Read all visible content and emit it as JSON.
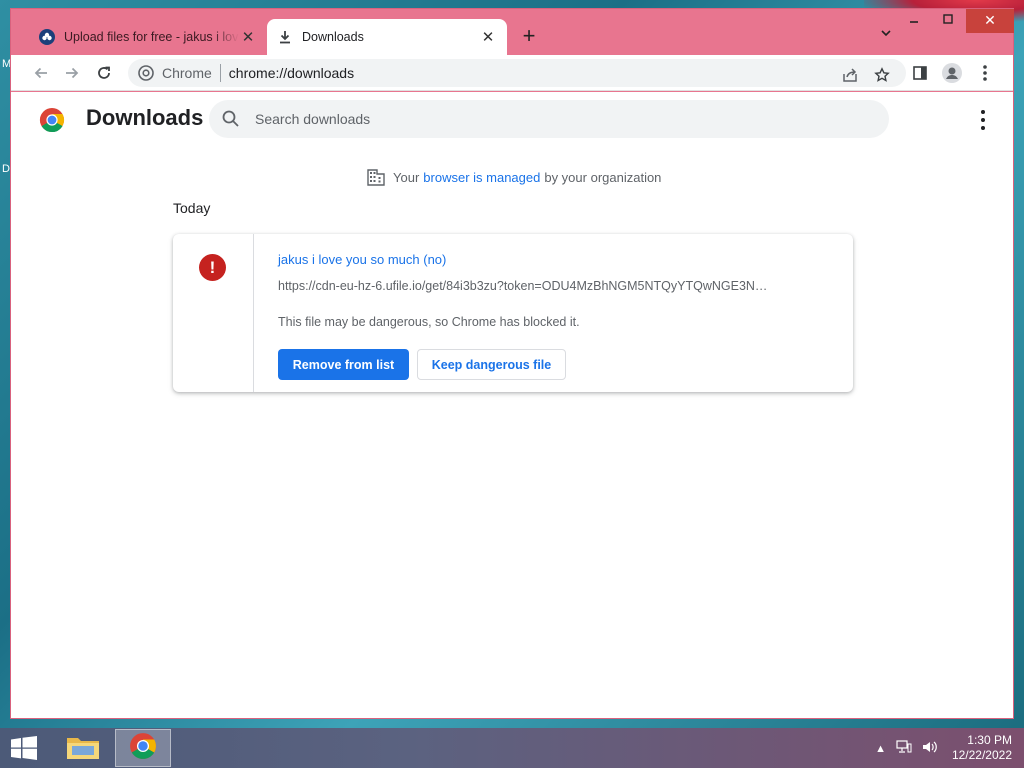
{
  "desktop": {
    "edge_letters": [
      "M",
      "D"
    ]
  },
  "browser": {
    "tabs": [
      {
        "title": "Upload files for free - jakus i love you so much (no)",
        "favicon": "ufile-icon",
        "active": false
      },
      {
        "title": "Downloads",
        "favicon": "download-icon",
        "active": true
      }
    ],
    "new_tab_label": "+",
    "omnibox": {
      "chip": "Chrome",
      "url": "chrome://downloads"
    }
  },
  "downloads_page": {
    "title": "Downloads",
    "search_placeholder": "Search downloads",
    "managed_notice": {
      "prefix": "Your",
      "link": "browser is managed",
      "suffix": "by your organization"
    },
    "date_group": "Today",
    "items": [
      {
        "file_name": "jakus i love you so much (no)",
        "url": "https://cdn-eu-hz-6.ufile.io/get/84i3b3zu?token=ODU4MzBhNGM5NTQyYTQwNGE3N…",
        "status": "This file may be dangerous, so Chrome has blocked it.",
        "primary_action": "Remove from list",
        "secondary_action": "Keep dangerous file",
        "status_icon": "warning-icon"
      }
    ]
  },
  "taskbar": {
    "clock_time": "1:30 PM",
    "clock_date": "12/22/2022"
  },
  "colors": {
    "window_frame": "#e8758f",
    "accent": "#1a73e8",
    "danger": "#c5221f"
  }
}
